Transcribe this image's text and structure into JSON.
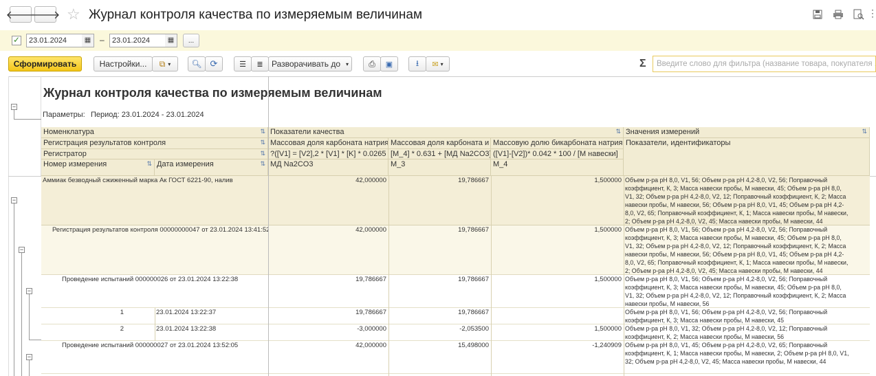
{
  "window": {
    "title": "Журнал контроля качества по измеряемым величинам"
  },
  "period": {
    "date_from": "23.01.2024",
    "dash": "–",
    "date_to": "23.01.2024",
    "more_label": "..."
  },
  "toolbar": {
    "generate_label": "Сформировать",
    "settings_label": "Настройки...",
    "expand_label": "Разворачивать до",
    "filter_placeholder": "Введите слово для фильтра (название товара, покупателя ...)",
    "sigma": "Σ"
  },
  "report": {
    "title": "Журнал контроля качества по измеряемым величинам",
    "params_label": "Параметры:",
    "period_text": "Период: 23.01.2024 - 23.01.2024",
    "headers": {
      "nomenclature": "Номенклатура",
      "reg_results": "Регистрация результатов контроля",
      "registrar": "Регистратор",
      "meas_number": "Номер измерения",
      "meas_date": "Дата измерения",
      "quality_indicators": "Показатели качества",
      "col1_name": "Массовая доля карбоната  натрия",
      "col1_formula": "?([V1] = [V2],2 * [V1] * [K] * 0.0265 *",
      "col1_code": "МД Na2CO3",
      "col2_name": "Массовая доля карбоната и",
      "col2_formula": "[M_4] * 0.631 + [МД Na2CO3]",
      "col2_code": "M_3",
      "col3_name": "Массовую долю бикарбоната натрия",
      "col3_formula": "([V1]-[V2])* 0.042 * 100 / [М навески]",
      "col3_code": "M_4",
      "measurements": "Значения измерений",
      "indicators_ids": "Показатели, идентификаторы"
    },
    "rows": [
      {
        "label": "Аммиак безводный сжиженный марка Ак ГОСТ 6221-90, налив",
        "v1": "42,000000",
        "v2": "19,786667",
        "v3": "1,500000",
        "measures": "Объем р-ра pH 8,0, V1, 56; Объем р-ра pH 4,2-8,0, V2, 56; Поправочный коэффициент, К, 3; Масса навески пробы, М навески, 45; Объем р-ра pH 8,0, V1, 32; Объем р-ра pH 4,2-8,0, V2, 12; Поправочный коэффициент, К, 2; Масса навески пробы, М навески, 56; Объем р-ра pH 8,0, V1, 45; Объем р-ра pH 4,2-8,0, V2, 65; Поправочный коэффициент, К, 1; Масса навески пробы, М навески, 2; Объем р-ра pH 4,2-8,0, V2, 45; Масса навески пробы, М навески, 44"
      },
      {
        "label": "Регистрация результатов контроля 00000000047 от 23.01.2024 13:41:52",
        "v1": "42,000000",
        "v2": "19,786667",
        "v3": "1,500000",
        "measures": "Объем р-ра pH 8,0, V1, 56; Объем р-ра pH 4,2-8,0, V2, 56; Поправочный коэффициент, К, 3; Масса навески пробы, М навески, 45; Объем р-ра pH 8,0, V1, 32; Объем р-ра pH 4,2-8,0, V2, 12; Поправочный коэффициент, К, 2; Масса навески пробы, М навески, 56; Объем р-ра pH 8,0, V1, 45; Объем р-ра pH 4,2-8,0, V2, 65; Поправочный коэффициент, К, 1; Масса навески пробы, М навески, 2; Объем р-ра pH 4,2-8,0, V2, 45; Масса навески пробы, М навески, 44"
      },
      {
        "label": "Проведение испытаний 000000026 от 23.01.2024 13:22:38",
        "v1": "19,786667",
        "v2": "19,786667",
        "v3": "1,500000",
        "measures": "Объем р-ра pH 8,0, V1, 56; Объем р-ра pH 4,2-8,0, V2, 56; Поправочный коэффициент, К, 3; Масса навески пробы, М навески, 45; Объем р-ра pH 8,0, V1, 32; Объем р-ра pH 4,2-8,0, V2, 12; Поправочный коэффициент, К, 2; Масса навески пробы, М навески, 56"
      },
      {
        "num": "1",
        "date": "23.01.2024 13:22:37",
        "v1": "19,786667",
        "v2": "19,786667",
        "v3": "",
        "measures": "Объем р-ра pH 8,0, V1, 56; Объем р-ра pH 4,2-8,0, V2, 56; Поправочный коэффициент, К, 3; Масса навески пробы, М навески, 45"
      },
      {
        "num": "2",
        "date": "23.01.2024 13:22:38",
        "v1": "-3,000000",
        "v2": "-2,053500",
        "v3": "1,500000",
        "measures": "Объем р-ра pH 8,0, V1, 32; Объем р-ра pH 4,2-8,0, V2, 12; Поправочный коэффициент, К, 2; Масса навески пробы, М навески, 56"
      },
      {
        "label": "Проведение испытаний 000000027 от 23.01.2024 13:52:05",
        "v1": "42,000000",
        "v2": "15,498000",
        "v3": "-1,240909",
        "measures": "Объем р-ра pH 8,0, V1, 45; Объем р-ра pH 4,2-8,0, V2, 65; Поправочный коэффициент, К, 1; Масса навески пробы, М навески, 2; Объем р-ра pH 8,0, V1, 32; Объем р-ра pH 4,2-8,0, V2, 45; Масса навески пробы, М навески, 44"
      }
    ]
  },
  "colors": {
    "period_bg": "#fbf8dc",
    "header_bg": "#f2ecd3",
    "group1_bg": "#f4eed7",
    "group2_bg": "#faf7e8",
    "primary_btn": "#f3c61a"
  },
  "icons": [
    "back-arrow-icon",
    "forward-arrow-icon",
    "favorite-star-icon",
    "save-icon",
    "print-icon",
    "preview-icon",
    "more-icon",
    "checkbox-icon",
    "calendar-icon",
    "copy-icon",
    "search-icon",
    "refresh-icon",
    "group-icon",
    "group-level-icon",
    "print-icon",
    "preview-icon",
    "save-file-icon",
    "email-icon",
    "sigma-icon",
    "collapse-icon"
  ]
}
